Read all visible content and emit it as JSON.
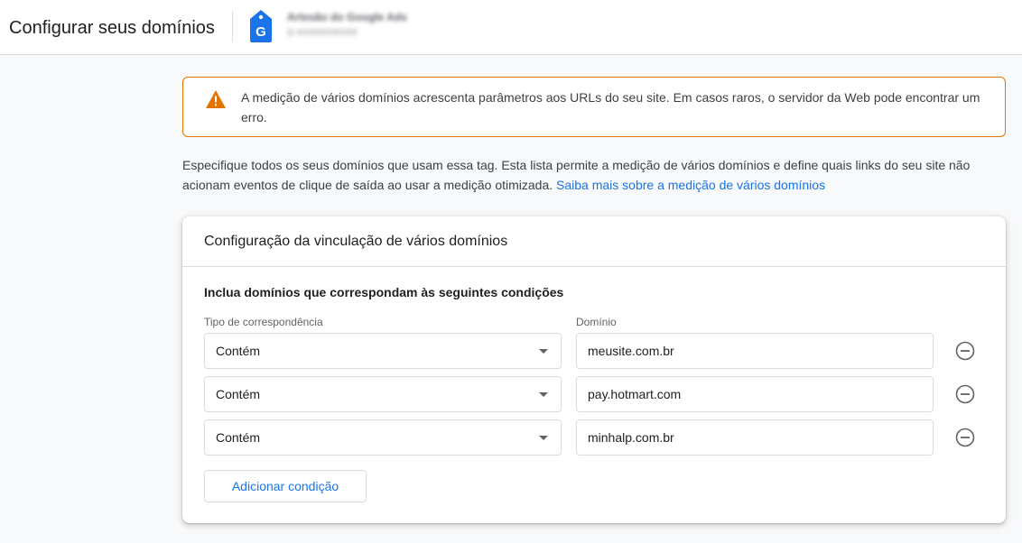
{
  "header": {
    "title": "Configurar seus domínios",
    "account_name": "Artesão do Google Ads",
    "account_id": "G-XXXXXXXXXX"
  },
  "warning": {
    "icon": "warning-icon",
    "color": "#e37400",
    "text": "A medição de vários domínios acrescenta parâmetros aos URLs do seu site. Em casos raros, o servidor da Web pode encontrar um erro."
  },
  "description": {
    "text": "Especifique todos os seus domínios que usam essa tag. Esta lista permite a medição de vários domínios e define quais links do seu site não acionam eventos de clique de saída ao usar a medição otimizada. ",
    "link_text": "Saiba mais sobre a medição de vários domínios",
    "link_color": "#1a73e8"
  },
  "card": {
    "title": "Configuração da vinculação de vários domínios",
    "section_title": "Inclua domínios que correspondam às seguintes condições",
    "match_type_label": "Tipo de correspondência",
    "domain_label": "Domínio",
    "rows": [
      {
        "match_type": "Contém",
        "domain": "meusite.com.br"
      },
      {
        "match_type": "Contém",
        "domain": "pay.hotmart.com"
      },
      {
        "match_type": "Contém",
        "domain": "minhalp.com.br"
      }
    ],
    "add_condition_label": "Adicionar condição"
  }
}
